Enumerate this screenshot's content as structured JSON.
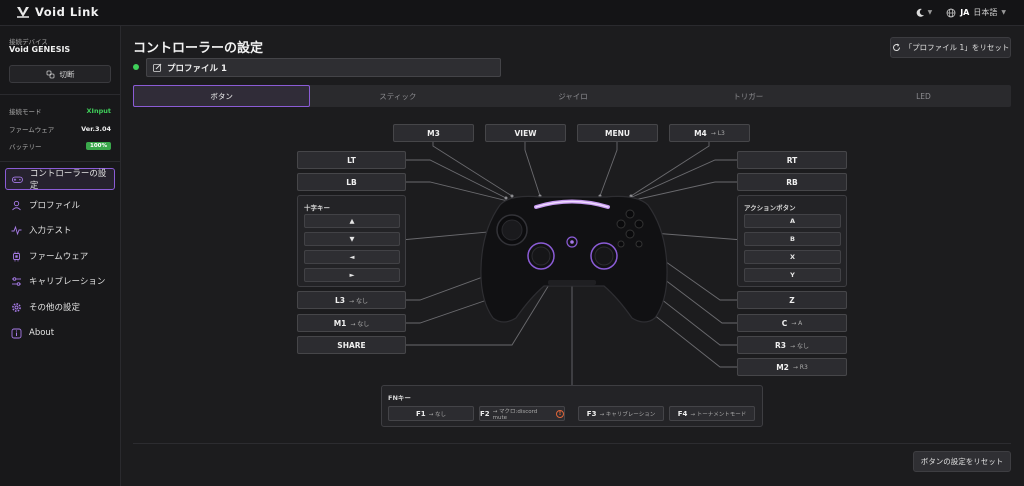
{
  "app": {
    "name": "Void Link"
  },
  "topbar": {
    "lang_code": "JA",
    "lang_name": "日本語"
  },
  "sidebar": {
    "device_label": "接続デバイス",
    "device_name": "Void GENESIS",
    "disconnect_label": "切断",
    "info": [
      {
        "label": "接続モード",
        "value": "XInput"
      },
      {
        "label": "ファームウェア",
        "value": "Ver.3.04"
      },
      {
        "label": "バッテリー",
        "value": "100%"
      }
    ],
    "nav": [
      {
        "label": "コントローラーの設定",
        "icon": "gamepad-icon"
      },
      {
        "label": "プロファイル",
        "icon": "user-icon"
      },
      {
        "label": "入力テスト",
        "icon": "pulse-icon"
      },
      {
        "label": "ファームウェア",
        "icon": "chip-icon"
      },
      {
        "label": "キャリブレーション",
        "icon": "sliders-icon"
      },
      {
        "label": "その他の設定",
        "icon": "gear-icon"
      },
      {
        "label": "About",
        "icon": "info-icon"
      }
    ]
  },
  "main": {
    "title": "コントローラーの設定",
    "reset_profile_label": "「プロファイル 1」をリセット",
    "profile_name": "プロファイル 1",
    "tabs": [
      "ボタン",
      "スティック",
      "ジャイロ",
      "トリガー",
      "LED"
    ],
    "reset_buttons_label": "ボタンの設定をリセット"
  },
  "mapping": {
    "top": [
      {
        "label": "M3",
        "sub": ""
      },
      {
        "label": "VIEW",
        "sub": ""
      },
      {
        "label": "MENU",
        "sub": ""
      },
      {
        "label": "M4",
        "sub": "→ L3"
      }
    ],
    "left": [
      {
        "label": "LT",
        "sub": ""
      },
      {
        "label": "LB",
        "sub": ""
      },
      {
        "label": "L3",
        "sub": "→ なし"
      },
      {
        "label": "M1",
        "sub": "→ なし"
      },
      {
        "label": "SHARE",
        "sub": ""
      }
    ],
    "dpad": {
      "title": "十字キー",
      "items": [
        "▲",
        "▼",
        "◄",
        "►"
      ]
    },
    "right": [
      {
        "label": "RT",
        "sub": ""
      },
      {
        "label": "RB",
        "sub": ""
      },
      {
        "label": "Z",
        "sub": ""
      },
      {
        "label": "C",
        "sub": "→ A"
      },
      {
        "label": "R3",
        "sub": "→ なし"
      },
      {
        "label": "M2",
        "sub": "→ R3"
      }
    ],
    "action": {
      "title": "アクションボタン",
      "items": [
        "A",
        "B",
        "X",
        "Y"
      ]
    },
    "fn": {
      "title": "FNキー",
      "items": [
        {
          "label": "F1",
          "sub": "→ なし"
        },
        {
          "label": "F2",
          "sub": "→ マクロ:discord mute"
        },
        {
          "label": "F3",
          "sub": "→ キャリブレーション"
        },
        {
          "label": "F4",
          "sub": "→ トーナメントモード"
        }
      ]
    }
  },
  "colors": {
    "accent": "#8b5cd6",
    "connected": "#3fcf5a",
    "battery": "#3aa84b",
    "warning": "#e0663a"
  }
}
